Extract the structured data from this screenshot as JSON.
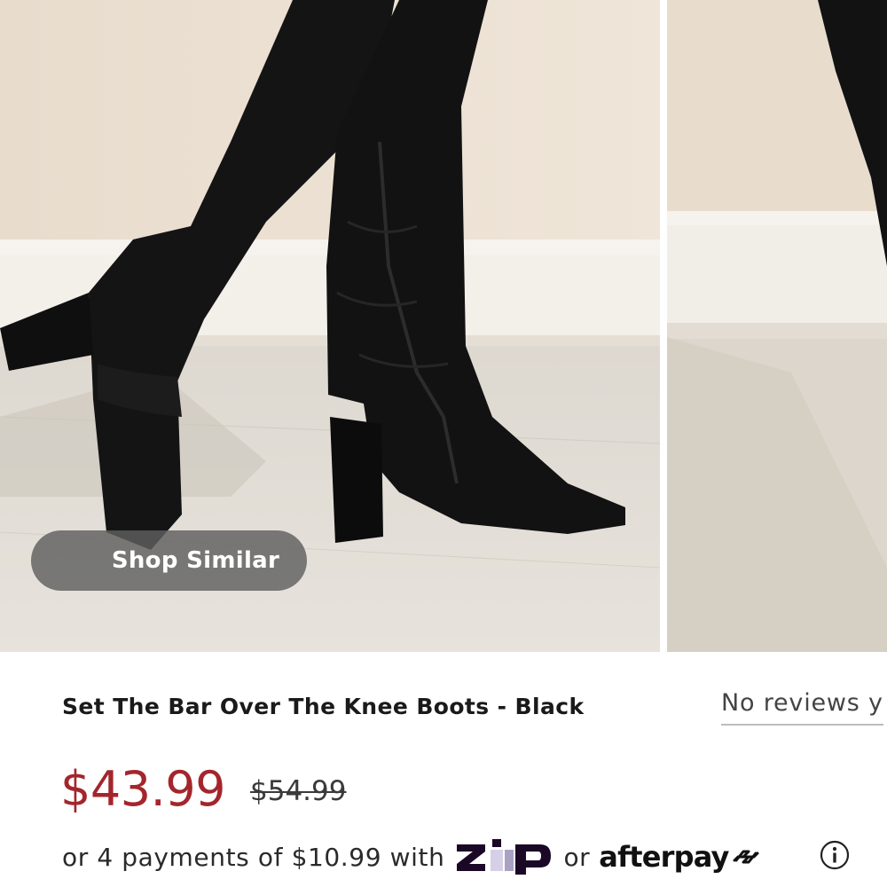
{
  "carousel": {
    "slides": [
      {
        "icon": "product-photo-boot-side"
      },
      {
        "icon": "product-photo-boot-next"
      }
    ],
    "shop_similar_label": "Shop Similar"
  },
  "product": {
    "title": "Set The Bar Over The Knee Boots - Black",
    "reviews_label": "No reviews y",
    "price_sale": "$43.99",
    "price_original": "$54.99",
    "sale_color": "#a3262c"
  },
  "payments": {
    "prefix": "or 4 payments of $10.99 with",
    "zip_label": "Zip",
    "middle": "or",
    "afterpay_label": "afterpay",
    "zip_color": "#1a0826",
    "info_icon": "info-icon"
  }
}
